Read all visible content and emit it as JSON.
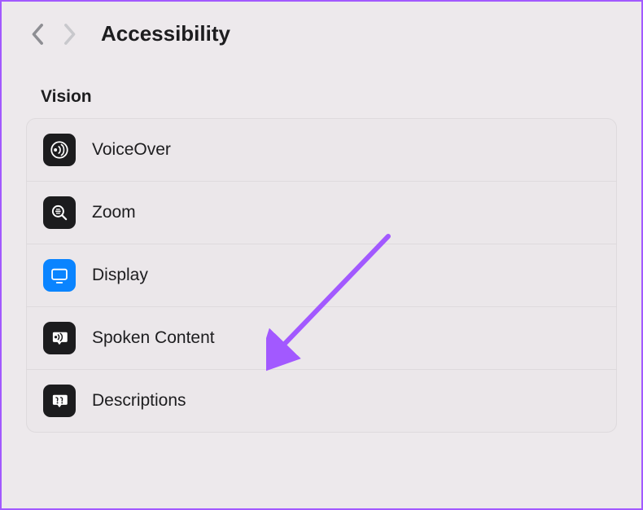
{
  "page_title": "Accessibility",
  "section_label": "Vision",
  "rows": [
    {
      "label": "VoiceOver"
    },
    {
      "label": "Zoom"
    },
    {
      "label": "Display"
    },
    {
      "label": "Spoken Content"
    },
    {
      "label": "Descriptions"
    }
  ]
}
